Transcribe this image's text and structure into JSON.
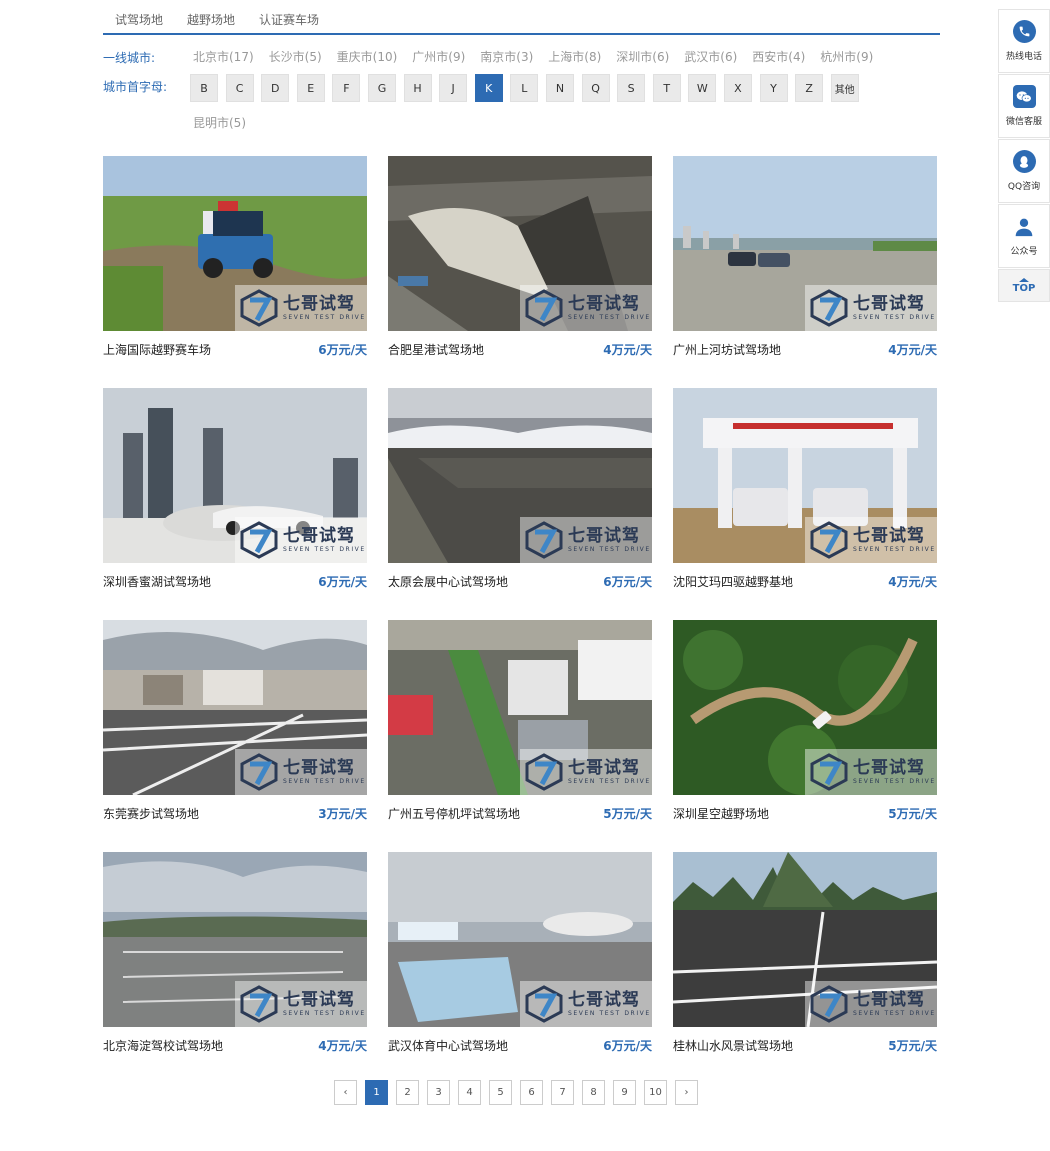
{
  "tabs": [
    "试驾场地",
    "越野场地",
    "认证赛车场"
  ],
  "filters": {
    "city_label": "一线城市:",
    "letter_label": "城市首字母:",
    "cities": [
      "北京市(17)",
      "长沙市(5)",
      "重庆市(10)",
      "广州市(9)",
      "南京市(3)",
      "上海市(8)",
      "深圳市(6)",
      "武汉市(6)",
      "西安市(4)",
      "杭州市(9)"
    ],
    "letters": [
      "B",
      "C",
      "D",
      "E",
      "F",
      "G",
      "H",
      "J",
      "K",
      "L",
      "N",
      "Q",
      "S",
      "T",
      "W",
      "X",
      "Y",
      "Z",
      "其他"
    ],
    "active_letter": "K",
    "extra_city": "昆明市(5)"
  },
  "watermark": {
    "cn": "七哥试驾",
    "en": "SEVEN TEST DRIVE"
  },
  "venues": [
    {
      "name": "上海国际越野赛车场",
      "price": "6万元/天",
      "scene": "offroad"
    },
    {
      "name": "合肥星港试驾场地",
      "price": "4万元/天",
      "scene": "aerial-track"
    },
    {
      "name": "广州上河坊试驾场地",
      "price": "4万元/天",
      "scene": "open-lot"
    },
    {
      "name": "深圳香蜜湖试驾场地",
      "price": "6万元/天",
      "scene": "city-drift"
    },
    {
      "name": "太原会展中心试驾场地",
      "price": "6万元/天",
      "scene": "expo-lot"
    },
    {
      "name": "沈阳艾玛四驱越野基地",
      "price": "4万元/天",
      "scene": "event-gate"
    },
    {
      "name": "东莞赛步试驾场地",
      "price": "3万元/天",
      "scene": "parking"
    },
    {
      "name": "广州五号停机坪试驾场地",
      "price": "5万元/天",
      "scene": "aerial-street"
    },
    {
      "name": "深圳星空越野场地",
      "price": "5万元/天",
      "scene": "forest"
    },
    {
      "name": "北京海淀驾校试驾场地",
      "price": "4万元/天",
      "scene": "driving-school"
    },
    {
      "name": "武汉体育中心试驾场地",
      "price": "6万元/天",
      "scene": "stadium"
    },
    {
      "name": "桂林山水风景试驾场地",
      "price": "5万元/天",
      "scene": "karst"
    }
  ],
  "pagination": {
    "prev": "‹",
    "pages": [
      "1",
      "2",
      "3",
      "4",
      "5",
      "6",
      "7",
      "8",
      "9",
      "10"
    ],
    "active": "1",
    "next": "›"
  },
  "sidebar": {
    "hotline": "热线电话",
    "wechat": "微信客服",
    "qq": "QQ咨询",
    "official": "公众号",
    "top": "TOP"
  },
  "colors": {
    "accent": "#2d6bb3"
  }
}
